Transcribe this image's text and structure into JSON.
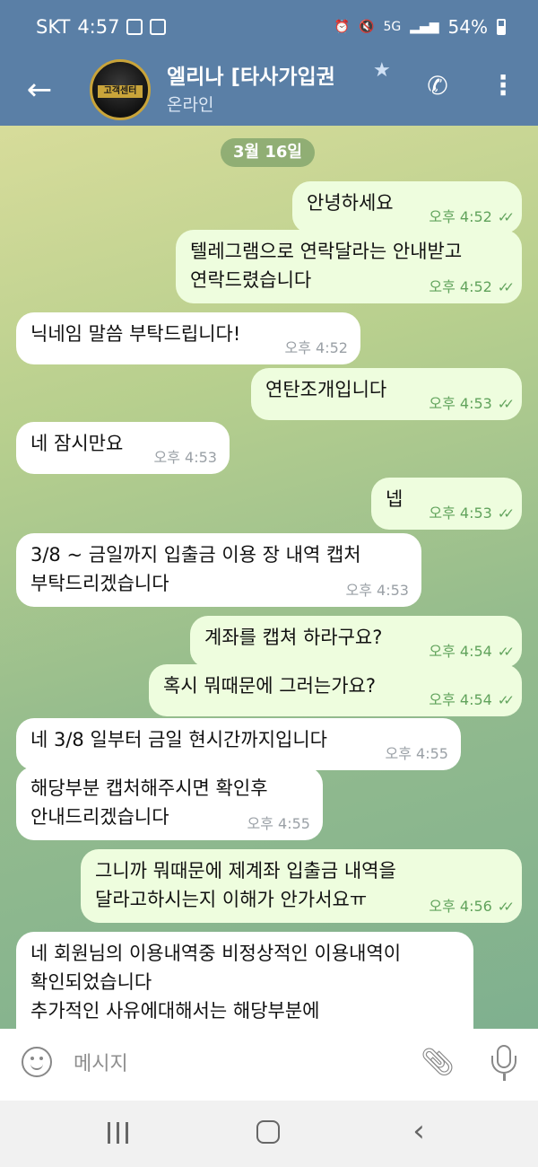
{
  "status_bar": {
    "carrier": "SKT",
    "time": "4:57",
    "network": "5G",
    "battery": "54%"
  },
  "header": {
    "title": "엘리나 [타사가입권",
    "status": "온라인",
    "avatar_text": "고객센터"
  },
  "chat": {
    "date": "3월 16일",
    "messages": [
      {
        "dir": "out",
        "text": "안녕하세요",
        "time": "오후 4:52"
      },
      {
        "dir": "out",
        "text": "텔레그램으로 연락달라는 안내받고\n연락드렸습니다",
        "time": "오후 4:52"
      },
      {
        "dir": "in",
        "text": "닉네임 말씀 부탁드립니다!",
        "time": "오후 4:52"
      },
      {
        "dir": "out",
        "text": "연탄조개입니다",
        "time": "오후 4:53"
      },
      {
        "dir": "in",
        "text": "네 잠시만요",
        "time": "오후 4:53"
      },
      {
        "dir": "out",
        "text": "넵",
        "time": "오후 4:53"
      },
      {
        "dir": "in",
        "text": "3/8 ~ 금일까지 입출금 이용 장 내역 캡처\n부탁드리겠습니다",
        "time": "오후 4:53"
      },
      {
        "dir": "out",
        "text": "계좌를 캡쳐 하라구요?",
        "time": "오후 4:54"
      },
      {
        "dir": "out",
        "text": "혹시 뭐때문에 그러는가요?",
        "time": "오후 4:54"
      },
      {
        "dir": "in",
        "text": "네 3/8 일부터 금일 현시간까지입니다",
        "time": "오후 4:55"
      },
      {
        "dir": "in",
        "text": "해당부분 캡처해주시면 확인후\n안내드리겠습니다",
        "time": "오후 4:55"
      },
      {
        "dir": "out",
        "text": "그니까 뭐때문에 제계좌 입출금 내역을\n달라고하시는지 이해가 안가서요ㅠ",
        "time": "오후 4:56"
      },
      {
        "dir": "in",
        "text": "네 회원님의 이용내역중 비정상적인 이용내역이\n확인되었습니다\n추가적인 사유에대해서는 해당부분에\n대해서 정상적으로 보내주시면 확인 후",
        "time": ""
      }
    ]
  },
  "input": {
    "placeholder": "메시지"
  },
  "icons": {
    "back": "back-arrow-icon",
    "star": "star-icon",
    "call": "phone-icon",
    "menu": "more-vertical-icon",
    "emoji": "emoji-icon",
    "attach": "paperclip-icon",
    "mic": "microphone-icon",
    "read": "double-check-icon"
  },
  "colors": {
    "header": "#5a7fa6",
    "outgoing_bubble": "#eefdde",
    "incoming_bubble": "#ffffff",
    "outgoing_meta": "#61a35c"
  }
}
